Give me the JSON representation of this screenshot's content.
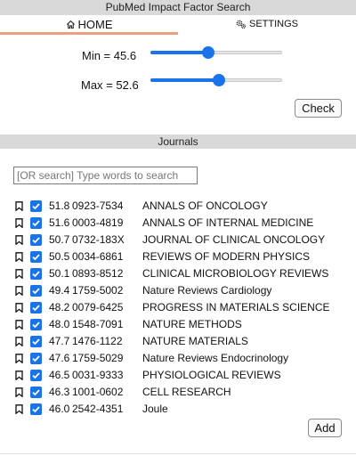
{
  "app": {
    "title": "PubMed Impact Factor Search"
  },
  "tabs": {
    "home": {
      "label": "HOME",
      "icon": "home-icon"
    },
    "settings": {
      "label": "SETTINGS",
      "icon": "gears-icon"
    }
  },
  "filters": {
    "min": {
      "label": "Min = 45.6",
      "value": 45.6,
      "fraction": 0.44
    },
    "max": {
      "label": "Max = 52.6",
      "value": 52.6,
      "fraction": 0.52
    },
    "check_label": "Check"
  },
  "journals_section": {
    "title": "Journals",
    "search_placeholder": "[OR search] Type words to search",
    "add_label": "Add",
    "items": [
      {
        "score": "51.8",
        "issn": "0923-7534",
        "name": "ANNALS OF ONCOLOGY",
        "checked": true
      },
      {
        "score": "51.6",
        "issn": "0003-4819",
        "name": "ANNALS OF INTERNAL MEDICINE",
        "checked": true
      },
      {
        "score": "50.7",
        "issn": "0732-183X",
        "name": "JOURNAL OF CLINICAL ONCOLOGY",
        "checked": true
      },
      {
        "score": "50.5",
        "issn": "0034-6861",
        "name": "REVIEWS OF MODERN PHYSICS",
        "checked": true
      },
      {
        "score": "50.1",
        "issn": "0893-8512",
        "name": "CLINICAL MICROBIOLOGY REVIEWS",
        "checked": true
      },
      {
        "score": "49.4",
        "issn": "1759-5002",
        "name": "Nature Reviews Cardiology",
        "checked": true
      },
      {
        "score": "48.2",
        "issn": "0079-6425",
        "name": "PROGRESS IN MATERIALS SCIENCE",
        "checked": true
      },
      {
        "score": "48.0",
        "issn": "1548-7091",
        "name": "NATURE METHODS",
        "checked": true
      },
      {
        "score": "47.7",
        "issn": "1476-1122",
        "name": "NATURE MATERIALS",
        "checked": true
      },
      {
        "score": "47.6",
        "issn": "1759-5029",
        "name": "Nature Reviews Endocrinology",
        "checked": true
      },
      {
        "score": "46.5",
        "issn": "0031-9333",
        "name": "PHYSIOLOGICAL REVIEWS",
        "checked": true
      },
      {
        "score": "46.3",
        "issn": "1001-0602",
        "name": "CELL RESEARCH",
        "checked": true
      },
      {
        "score": "46.0",
        "issn": "2542-4351",
        "name": "Joule",
        "checked": true
      }
    ]
  },
  "colors": {
    "accent": "#1a73e8",
    "tab_underline": "#e9a07e",
    "bar_bg": "#d9d9d9"
  }
}
